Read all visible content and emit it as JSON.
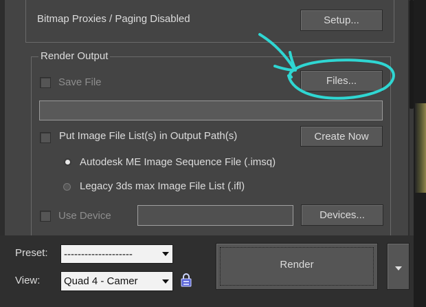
{
  "bitmap": {
    "status_label": "Bitmap Proxies / Paging Disabled",
    "setup_label": "Setup..."
  },
  "render_output": {
    "group_title": "Render Output",
    "save_file_label": "Save File",
    "save_file_checked": false,
    "files_label": "Files...",
    "output_path_value": "",
    "put_image_list_label": "Put Image File List(s) in Output Path(s)",
    "put_image_list_checked": false,
    "create_now_label": "Create Now",
    "radio_options": [
      {
        "label": "Autodesk ME Image Sequence File (.imsq)",
        "selected": true
      },
      {
        "label": "Legacy 3ds max Image File List (.ifl)",
        "selected": false
      }
    ],
    "use_device_label": "Use Device",
    "use_device_checked": false,
    "device_value": "",
    "devices_label": "Devices..."
  },
  "bottom": {
    "preset_label": "Preset:",
    "preset_value": "--------------------",
    "view_label": "View:",
    "view_value": "Quad 4 - Camer",
    "render_label": "Render"
  },
  "colors": {
    "annotation": "#2fd6d2",
    "panel_bg": "#444444"
  },
  "icons": {
    "lock": "lock-icon",
    "dropdown": "chevron-down-icon"
  }
}
